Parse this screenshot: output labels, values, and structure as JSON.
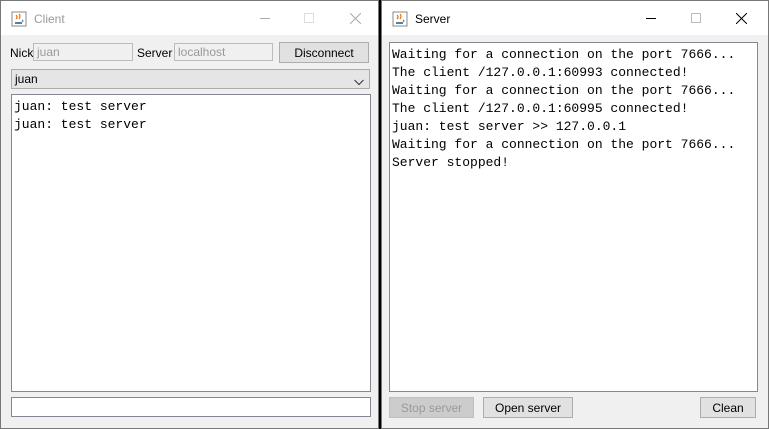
{
  "client": {
    "title": "Client",
    "nick_label": "Nick",
    "nick_value": "juan",
    "server_label": "Server",
    "server_value": "localhost",
    "disconnect_label": "Disconnect",
    "recipient_selected": "juan",
    "messages": [
      "juan: test server",
      "juan: test server"
    ],
    "message_input_value": ""
  },
  "server": {
    "title": "Server",
    "log": [
      "Waiting for a connection on the port 7666...",
      "The client /127.0.0.1:60993 connected!",
      "Waiting for a connection on the port 7666...",
      "The client /127.0.0.1:60995 connected!",
      "juan: test server >> 127.0.0.1",
      "Waiting for a connection on the port 7666...",
      "Server stopped!"
    ],
    "stop_label": "Stop server",
    "stop_disabled": true,
    "open_label": "Open server",
    "clean_label": "Clean"
  },
  "icons": {
    "app": "java-coffee-cup-icon",
    "minimize": "minimize-icon",
    "maximize": "maximize-icon",
    "close": "close-icon",
    "dropdown": "chevron-down-icon"
  }
}
